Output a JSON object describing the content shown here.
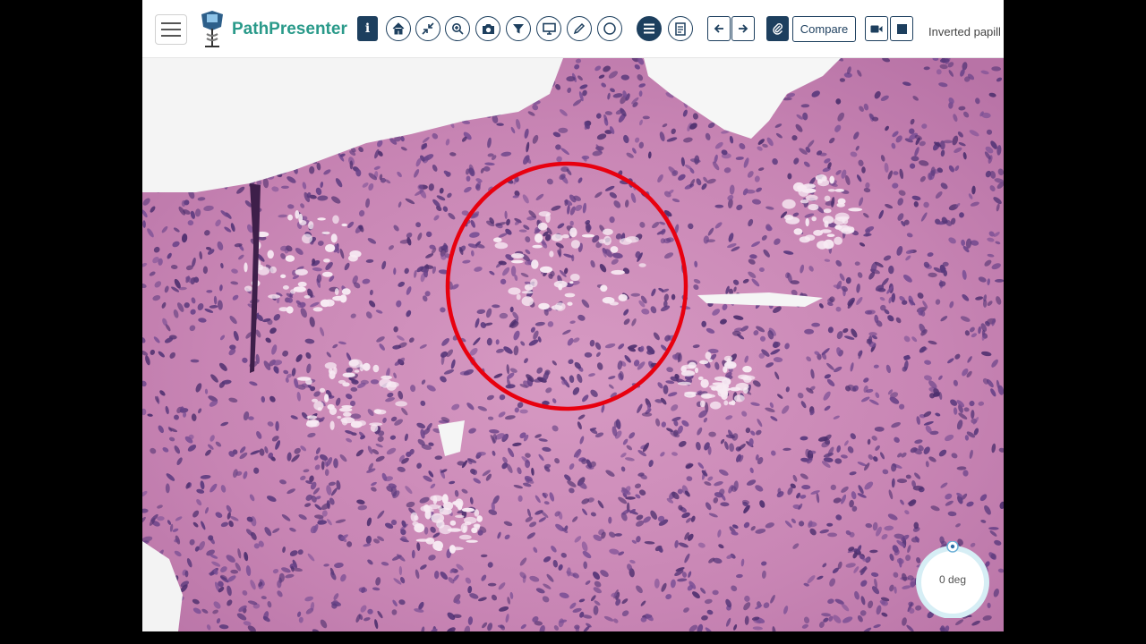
{
  "app": {
    "brand": "PathPresenter"
  },
  "toolbar": {
    "menu_icon": "hamburger-icon",
    "buttons": [
      {
        "name": "info-button",
        "icon": "info-icon"
      },
      {
        "name": "home-button",
        "icon": "home-icon"
      },
      {
        "name": "fit-button",
        "icon": "collapse-arrows-icon"
      },
      {
        "name": "zoom-button",
        "icon": "magnifier-icon"
      },
      {
        "name": "snapshot-button",
        "icon": "camera-icon"
      },
      {
        "name": "filter-button",
        "icon": "funnel-icon"
      },
      {
        "name": "present-button",
        "icon": "monitor-icon"
      },
      {
        "name": "annotate-button",
        "icon": "pencil-icon"
      },
      {
        "name": "rotate-button",
        "icon": "circle-icon"
      },
      {
        "name": "list-button",
        "icon": "list-icon"
      },
      {
        "name": "notes-button",
        "icon": "document-icon"
      },
      {
        "name": "prev-button",
        "icon": "arrow-left-icon"
      },
      {
        "name": "next-button",
        "icon": "arrow-right-icon"
      },
      {
        "name": "link-button",
        "icon": "paperclip-icon"
      },
      {
        "name": "record-button",
        "icon": "video-camera-icon"
      },
      {
        "name": "stop-button",
        "icon": "stop-icon"
      }
    ],
    "compare_label": "Compare",
    "slide_title": "Inverted papill"
  },
  "viewer": {
    "annotation_color": "#e8000f",
    "rotation_label": "0 deg"
  },
  "colors": {
    "primary": "#1d3f5e",
    "brand": "#2a9a8a",
    "tissue": "#c98ab4",
    "nuclei": "#5b3a7e"
  }
}
